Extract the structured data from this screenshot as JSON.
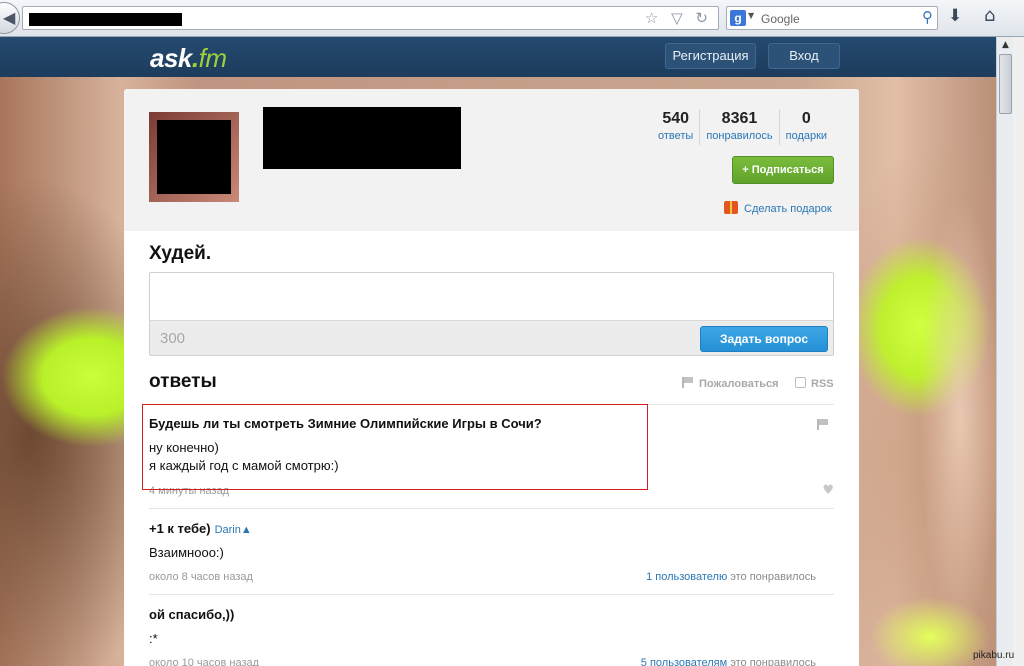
{
  "browser": {
    "search_placeholder": "Google",
    "url_icons": "☆ ▽ ↻"
  },
  "header": {
    "logo_main": "ask",
    "logo_dot": ".",
    "logo_fm": "fm",
    "register_label": "Регистрация",
    "login_label": "Вход"
  },
  "profile": {
    "stats": [
      {
        "value": "540",
        "label": "ответы"
      },
      {
        "value": "8361",
        "label": "понравилось"
      },
      {
        "value": "0",
        "label": "подарки"
      }
    ],
    "subscribe_label": "+ Подписаться",
    "gift_label": "Сделать подарок",
    "bio": "Худей."
  },
  "ask": {
    "char_count": "300",
    "button_label": "Задать вопрос"
  },
  "answers": {
    "title": "ответы",
    "report_label": "Пожаловаться",
    "rss_label": "RSS",
    "items": [
      {
        "question": "Будешь ли ты смотреть Зимние Олимпийские Игры в Сочи?",
        "answer_line1": "ну конечно)",
        "answer_line2": "я каждый год с мамой смотрю:)",
        "time": "4 минуты назад"
      },
      {
        "question": "+1 к тебе)",
        "author": "Darin▲",
        "answer_line1": "Взаимнооо:)",
        "time": "около 8 часов назад",
        "likes_users": "1 пользователю",
        "likes_suffix": "это понравилось"
      },
      {
        "question": "ой спасибо,))",
        "answer_line1": ":*",
        "time": "около 10 часов назад",
        "likes_users": "5 пользователям",
        "likes_suffix": "это понравилось"
      }
    ]
  },
  "watermark": "pikabu.ru"
}
